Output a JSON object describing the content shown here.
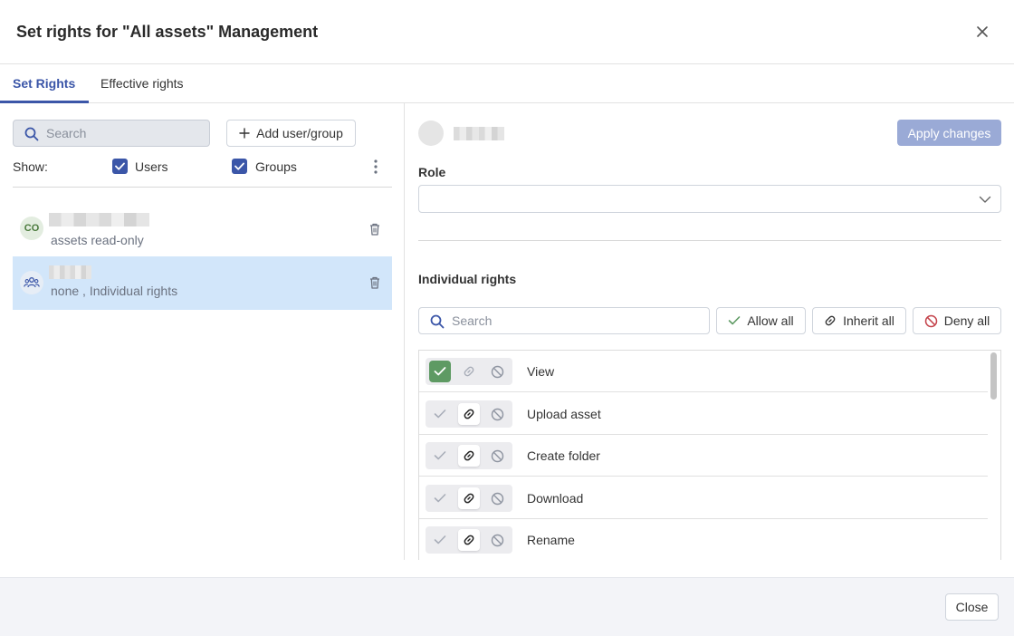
{
  "dialog": {
    "title": "Set rights for \"All assets\" Management"
  },
  "tabs": [
    {
      "label": "Set Rights",
      "active": true
    },
    {
      "label": "Effective rights",
      "active": false
    }
  ],
  "left": {
    "search_placeholder": "Search",
    "add_label": "Add user/group",
    "show_label": "Show:",
    "filters": [
      {
        "label": "Users",
        "checked": true
      },
      {
        "label": "Groups",
        "checked": true
      }
    ],
    "entries": [
      {
        "avatar_text": "CO",
        "type": "user",
        "subtitle": "assets read-only",
        "selected": false
      },
      {
        "avatar_text": "",
        "type": "group",
        "subtitle": "none , Individual rights",
        "selected": true
      }
    ]
  },
  "right": {
    "apply_label": "Apply changes",
    "role_label": "Role",
    "role_value": "",
    "individual_rights_label": "Individual rights",
    "search_placeholder": "Search",
    "allow_all_label": "Allow all",
    "inherit_all_label": "Inherit all",
    "deny_all_label": "Deny all",
    "rights": [
      {
        "name": "View",
        "state": "allow"
      },
      {
        "name": "Upload asset",
        "state": "inherit"
      },
      {
        "name": "Create folder",
        "state": "inherit"
      },
      {
        "name": "Download",
        "state": "inherit"
      },
      {
        "name": "Rename",
        "state": "inherit"
      }
    ]
  },
  "footer": {
    "close_label": "Close"
  },
  "colors": {
    "accent": "#3b56a8",
    "allow_green": "#5e9a63",
    "apply_disabled": "#9aaad6",
    "deny_red": "#c4424a",
    "selected_row": "#d2e6fa"
  }
}
